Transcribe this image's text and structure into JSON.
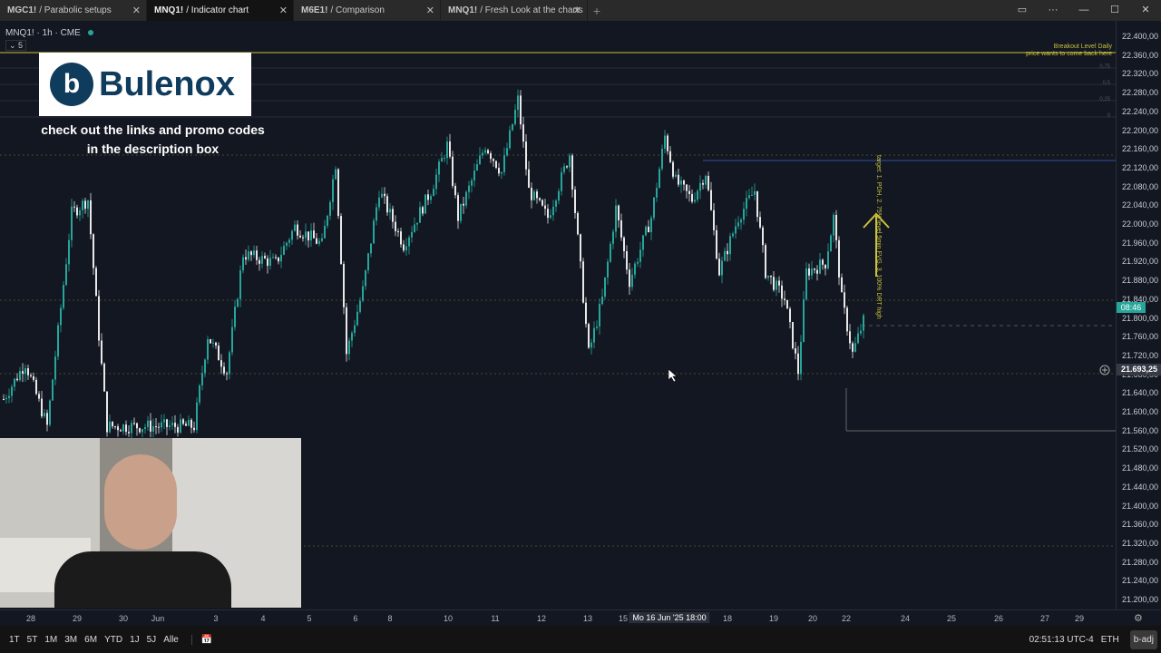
{
  "tabs": [
    {
      "symbol": "MGC1!",
      "name": "/ Parabolic setups"
    },
    {
      "symbol": "MNQ1!",
      "name": "/ Indicator chart"
    },
    {
      "symbol": "M6E1!",
      "name": "/ Comparison"
    },
    {
      "symbol": "MNQ1!",
      "name": "/ Fresh Look at the charts"
    }
  ],
  "legend": {
    "title": "MNQ1! · 1h · CME",
    "collapse": "5"
  },
  "overlay": {
    "brand": "Bulenox",
    "promo_line1": "check out the links and promo codes",
    "promo_line2": "in the description box"
  },
  "annotations": {
    "breakout_title": "Breakout Level Daily",
    "breakout_sub": "price wants to come back here",
    "targets": "target: 1. PDH, 2. 75% level 5min FVG, 3. 100% DRT high",
    "fib_075": "0,75",
    "fib_05": "0,5",
    "fib_025": "0,25",
    "fib_0": "0"
  },
  "price_axis": {
    "labels": [
      "22.400,00",
      "22.360,00",
      "22.320,00",
      "22.280,00",
      "22.240,00",
      "22.200,00",
      "22.160,00",
      "22.120,00",
      "22.080,00",
      "22.040,00",
      "22.000,00",
      "21.960,00",
      "21.920,00",
      "21.880,00",
      "21.840,00",
      "21.800,00",
      "21.760,00",
      "21.720,00",
      "21.680,00",
      "21.640,00",
      "21.600,00",
      "21.560,00",
      "21.520,00",
      "21.480,00",
      "21.440,00",
      "21.400,00",
      "21.360,00",
      "21.320,00",
      "21.280,00",
      "21.240,00",
      "21.200,00"
    ],
    "countdown": "08:46",
    "crosshair_price": "21.693,25"
  },
  "time_axis": {
    "labels": [
      "28",
      "29",
      "30",
      "Jun",
      "3",
      "4",
      "5",
      "6",
      "8",
      "10",
      "11",
      "12",
      "13",
      "15",
      "Mo 16 Jun '25  18:00",
      "18",
      "19",
      "20",
      "22",
      "24",
      "25",
      "26",
      "27",
      "29"
    ]
  },
  "bottom_bar": {
    "ranges": [
      "1T",
      "5T",
      "1M",
      "3M",
      "6M",
      "YTD",
      "1J",
      "5J",
      "Alle"
    ],
    "clock": "02:51:13 UTC-4",
    "session": "ETH",
    "adj": "b-adj"
  },
  "colors": {
    "up": "#26a69a",
    "down": "#e8e8e8",
    "accent": "#c9c23a"
  },
  "chart_data": {
    "type": "candlestick",
    "symbol": "MNQ1!",
    "interval": "1h",
    "ylim": [
      21180,
      22420
    ],
    "keyframes": [
      [
        0,
        21629
      ],
      [
        8,
        21706
      ],
      [
        16,
        21571
      ],
      [
        25,
        22025
      ],
      [
        31,
        22054
      ],
      [
        35,
        21764
      ],
      [
        38,
        21571
      ],
      [
        53,
        21571
      ],
      [
        70,
        21571
      ],
      [
        75,
        21764
      ],
      [
        82,
        21687
      ],
      [
        88,
        21938
      ],
      [
        100,
        21919
      ],
      [
        107,
        21996
      ],
      [
        117,
        21958
      ],
      [
        122,
        22131
      ],
      [
        126,
        21726
      ],
      [
        132,
        21861
      ],
      [
        138,
        22073
      ],
      [
        147,
        21958
      ],
      [
        157,
        22073
      ],
      [
        163,
        22170
      ],
      [
        167,
        22016
      ],
      [
        177,
        22170
      ],
      [
        183,
        22112
      ],
      [
        189,
        22267
      ],
      [
        193,
        22073
      ],
      [
        200,
        22016
      ],
      [
        208,
        22151
      ],
      [
        215,
        21726
      ],
      [
        220,
        21842
      ],
      [
        225,
        22035
      ],
      [
        230,
        21880
      ],
      [
        238,
        22016
      ],
      [
        243,
        22189
      ],
      [
        247,
        22093
      ],
      [
        253,
        22054
      ],
      [
        258,
        22112
      ],
      [
        263,
        21900
      ],
      [
        270,
        22016
      ],
      [
        276,
        22073
      ],
      [
        280,
        21900
      ],
      [
        287,
        21842
      ],
      [
        292,
        21687
      ],
      [
        295,
        21900
      ],
      [
        302,
        21919
      ],
      [
        305,
        22016
      ],
      [
        308,
        21842
      ],
      [
        312,
        21726
      ],
      [
        317,
        21813
      ]
    ]
  }
}
